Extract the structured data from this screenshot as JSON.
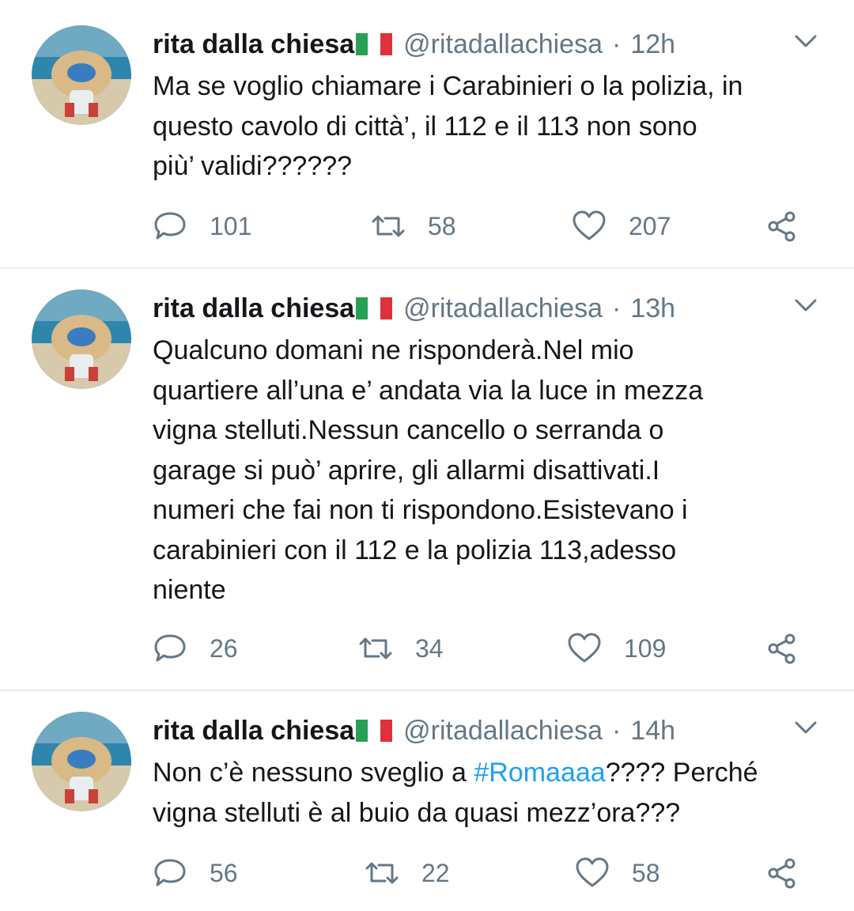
{
  "tweets": [
    {
      "name": "rita dalla chiesa",
      "handle": "@ritadallachiesa",
      "dot": "·",
      "time": "12h",
      "lines": [
        [
          "Ma se voglio chiamare i Carabinieri o la polizia, in"
        ],
        [
          "questo cavolo di città’, il 112 e il 113 non sono"
        ],
        [
          "più’ validi??????"
        ]
      ],
      "replies": "101",
      "retweets": "58",
      "likes": "207"
    },
    {
      "name": "rita dalla chiesa",
      "handle": "@ritadallachiesa",
      "dot": "·",
      "time": "13h",
      "lines": [
        [
          "Qualcuno domani ne risponderà.Nel mio"
        ],
        [
          "quartiere all’una e’ andata via la luce in mezza"
        ],
        [
          "vigna stelluti.Nessun cancello o serranda o"
        ],
        [
          "garage si può’ aprire, gli allarmi disattivati.I"
        ],
        [
          "numeri che fai non ti rispondono.Esistevano i"
        ],
        [
          "carabinieri con il 112 e la polizia 113,adesso"
        ],
        [
          "niente"
        ]
      ],
      "replies": "26",
      "retweets": "34",
      "likes": "109"
    },
    {
      "name": "rita dalla chiesa",
      "handle": "@ritadallachiesa",
      "dot": "·",
      "time": "14h",
      "lines": [
        [
          "Non c’è nessuno sveglio a ",
          "#Romaaaa",
          "???? Perché"
        ],
        [
          "vigna stelluti è al buio da quasi mezz’ora???"
        ]
      ],
      "replies": "56",
      "retweets": "22",
      "likes": "58"
    }
  ],
  "icons": {
    "reply": "reply-icon",
    "retweet": "retweet-icon",
    "like": "heart-icon",
    "share": "share-icon",
    "menu": "chevron-down-icon",
    "flag": "italian-flag-icon"
  },
  "colors": {
    "text": "#14171a",
    "secondary": "#657786",
    "hashtag": "#1da1f2",
    "divider": "#e6ecf0"
  }
}
